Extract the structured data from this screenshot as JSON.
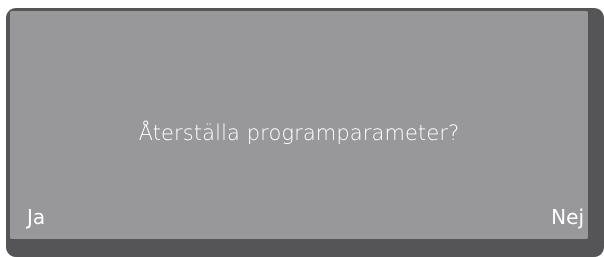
{
  "dialog": {
    "message": "Återställa programparameter?",
    "left_softkey": "Ja",
    "right_softkey": "Nej"
  },
  "colors": {
    "bezel": "#555558",
    "screen": "#98989a",
    "text": "#ffffff"
  }
}
